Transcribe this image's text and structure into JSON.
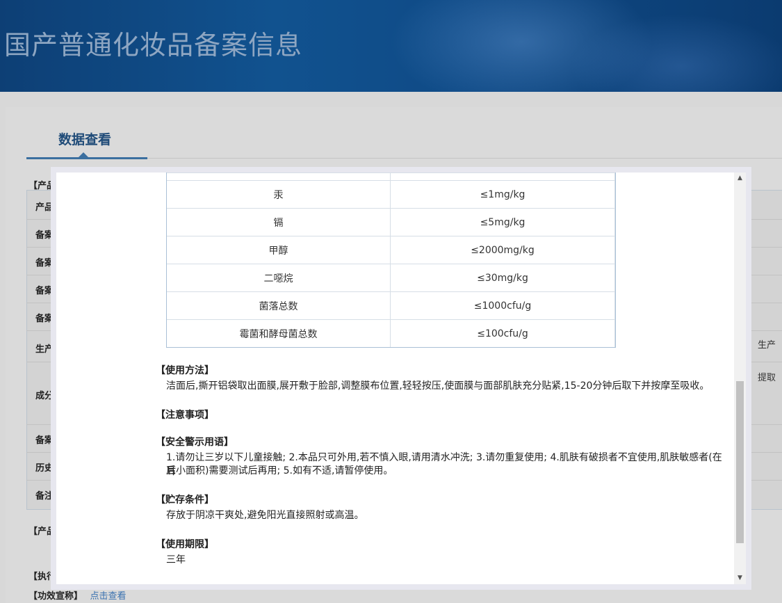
{
  "header": {
    "title": "国产普通化妆品备案信息"
  },
  "background": {
    "tab_label": "数据查看",
    "section_product": "【产品",
    "rows": [
      "产品",
      "备案",
      "备案",
      "备案",
      "备案",
      "生产",
      "成分",
      "备案",
      "历史",
      "备注"
    ],
    "right_fragments": [
      "生产",
      "提取"
    ],
    "section_product2": "【产品",
    "section_exec": "【执行",
    "efficacy_label": "【功效宣称】",
    "efficacy_link": "点击查看"
  },
  "modal": {
    "table": {
      "rows": [
        {
          "item": "汞",
          "limit": "≤1mg/kg"
        },
        {
          "item": "镉",
          "limit": "≤5mg/kg"
        },
        {
          "item": "甲醇",
          "limit": "≤2000mg/kg"
        },
        {
          "item": "二噁烷",
          "limit": "≤30mg/kg"
        },
        {
          "item": "菌落总数",
          "limit": "≤1000cfu/g"
        },
        {
          "item": "霉菌和酵母菌总数",
          "limit": "≤100cfu/g"
        }
      ]
    },
    "usage_title": "【使用方法】",
    "usage_body": "洁面后,撕开铝袋取出面膜,展开敷于脸部,调整膜布位置,轻轻按压,使面膜与面部肌肤充分贴紧,15-20分钟后取下并按摩至吸收。",
    "notes_title": "【注意事项】",
    "warning_title": "【安全警示用语】",
    "warning_body_line1": "1.请勿让三岁以下儿童接触; 2.本品只可外用,若不慎入眼,请用清水冲洗; 3.请勿重复使用; 4.肌肤有破损者不宜使用,肌肤敏感者(在耳",
    "warning_body_line2": "后小面积)需要测试后再用;   5.如有不适,请暂停使用。",
    "storage_title": "【贮存条件】",
    "storage_body": "存放于阴凉干爽处,避免阳光直接照射或高温。",
    "shelf_title": "【使用期限】",
    "shelf_body": "三年"
  },
  "scrollbar": {
    "up_icon": "▲",
    "down_icon": "▼"
  }
}
